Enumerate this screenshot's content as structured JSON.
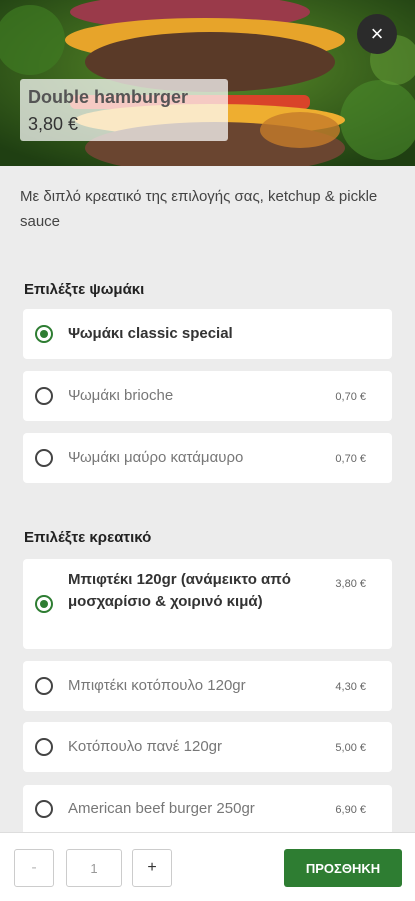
{
  "product": {
    "name": "Double hamburger",
    "price": "3,80 €",
    "description": "Με διπλό κρεατικό της επιλογής σας, ketchup & pickle sauce"
  },
  "close_icon": "×",
  "sections": [
    {
      "title": "Επιλέξτε ψωμάκι",
      "options": [
        {
          "label": "Ψωμάκι classic special",
          "price": "",
          "selected": true
        },
        {
          "label": "Ψωμάκι brioche",
          "price": "0,70 €",
          "selected": false
        },
        {
          "label": "Ψωμάκι μαύρο κατάμαυρο",
          "price": "0,70 €",
          "selected": false
        }
      ]
    },
    {
      "title": "Επιλέξτε κρεατικό",
      "options": [
        {
          "label": "Μπιφτέκι 120gr (ανάμεικτο από μοσχαρίσιο & χοιρινό κιμά)",
          "price": "3,80 €",
          "selected": true
        },
        {
          "label": "Μπιφτέκι κοτόπουλο 120gr",
          "price": "4,30 €",
          "selected": false
        },
        {
          "label": "Κοτόπουλο πανέ 120gr",
          "price": "5,00 €",
          "selected": false
        },
        {
          "label": "American beef burger 250gr",
          "price": "6,90 €",
          "selected": false
        }
      ]
    }
  ],
  "footer": {
    "minus": "-",
    "quantity": "1",
    "plus": "+",
    "add_label": "ΠΡΟΣΘΗΚΗ"
  },
  "colors": {
    "accent": "#2e7d32"
  }
}
